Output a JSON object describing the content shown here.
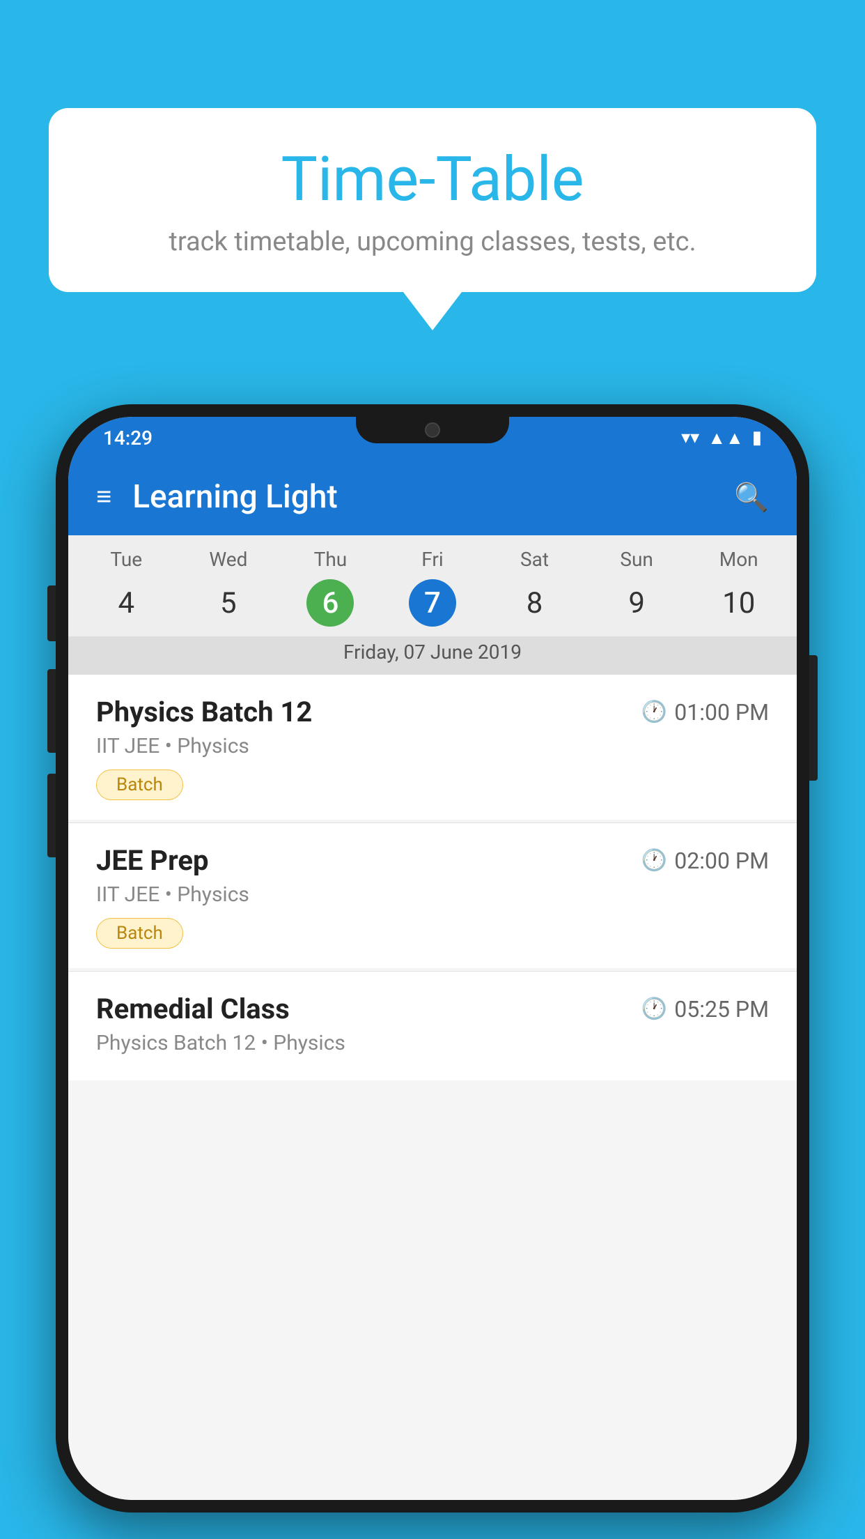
{
  "background_color": "#29b6e8",
  "speech_bubble": {
    "title": "Time-Table",
    "subtitle": "track timetable, upcoming classes, tests, etc."
  },
  "status_bar": {
    "time": "14:29",
    "icons": [
      "wifi",
      "signal",
      "battery"
    ]
  },
  "app_bar": {
    "title": "Learning Light",
    "menu_icon": "≡",
    "search_icon": "🔍"
  },
  "calendar": {
    "days": [
      {
        "label": "Tue",
        "num": "4"
      },
      {
        "label": "Wed",
        "num": "5"
      },
      {
        "label": "Thu",
        "num": "6",
        "state": "today"
      },
      {
        "label": "Fri",
        "num": "7",
        "state": "selected"
      },
      {
        "label": "Sat",
        "num": "8"
      },
      {
        "label": "Sun",
        "num": "9"
      },
      {
        "label": "Mon",
        "num": "10"
      }
    ],
    "selected_date_label": "Friday, 07 June 2019"
  },
  "events": [
    {
      "name": "Physics Batch 12",
      "time": "01:00 PM",
      "subtitle": "IIT JEE • Physics",
      "tag": "Batch"
    },
    {
      "name": "JEE Prep",
      "time": "02:00 PM",
      "subtitle": "IIT JEE • Physics",
      "tag": "Batch"
    },
    {
      "name": "Remedial Class",
      "time": "05:25 PM",
      "subtitle": "Physics Batch 12 • Physics"
    }
  ],
  "icons": {
    "hamburger": "≡",
    "search": "⌕",
    "clock": "🕐"
  }
}
